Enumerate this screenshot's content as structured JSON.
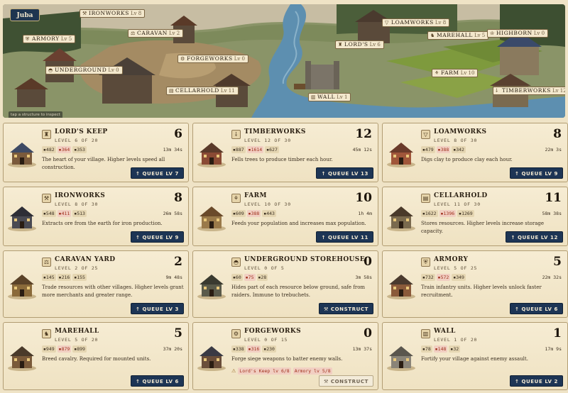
{
  "village": {
    "name": "Juba"
  },
  "map": {
    "hint": "tap a structure to inspect",
    "labels": [
      {
        "key": "ironworks",
        "name": "IRONWORKS",
        "lv": "Lv 8",
        "icon": "anvil-icon",
        "glyph": "⚒"
      },
      {
        "key": "armory",
        "name": "ARMORY",
        "lv": "Lv 5",
        "icon": "shield-icon",
        "glyph": "⛨"
      },
      {
        "key": "caravan",
        "name": "CARAVAN",
        "lv": "Lv 2",
        "icon": "scale-icon",
        "glyph": "⚖"
      },
      {
        "key": "forgeworks",
        "name": "FORGEWORKS",
        "lv": "Lv 0",
        "icon": "catapult-icon",
        "glyph": "⚙"
      },
      {
        "key": "underground",
        "name": "UNDERGROUND",
        "lv": "Lv 0",
        "icon": "cave-icon",
        "glyph": "◓"
      },
      {
        "key": "cellarhold",
        "name": "CELLARHOLD",
        "lv": "Lv 11",
        "icon": "crate-icon",
        "glyph": "▤"
      },
      {
        "key": "lords",
        "name": "LORD'S",
        "lv": "Lv 6",
        "icon": "castle-icon",
        "glyph": "♜"
      },
      {
        "key": "wall",
        "name": "WALL",
        "lv": "Lv 1",
        "icon": "wall-icon",
        "glyph": "▥"
      },
      {
        "key": "loamworks",
        "name": "LOAMWORKS",
        "lv": "Lv 8",
        "icon": "bucket-icon",
        "glyph": "▽"
      },
      {
        "key": "marehall",
        "name": "MAREHALL",
        "lv": "Lv 5",
        "icon": "horse-icon",
        "glyph": "♞"
      },
      {
        "key": "highborn",
        "name": "HIGHBORN",
        "lv": "Lv 0",
        "icon": "crown-icon",
        "glyph": "♔"
      },
      {
        "key": "farm",
        "name": "FARM",
        "lv": "Lv 10",
        "icon": "wheat-icon",
        "glyph": "⚘"
      },
      {
        "key": "timberworks",
        "name": "TIMBERWORKS",
        "lv": "Lv 12",
        "icon": "axe-icon",
        "glyph": "⸸"
      }
    ]
  },
  "colors": {
    "queue_button": "#1d3555",
    "short_resource": "#a0301e",
    "card_background": "#f6ecd3",
    "page_background": "#efe3c6"
  },
  "buildings": [
    {
      "key": "lords_keep",
      "name": "LORD'S KEEP",
      "icon": "castle-icon",
      "glyph": "♜",
      "level_text": "LEVEL 6 OF 20",
      "level": "6",
      "costs": [
        {
          "v": "▪482",
          "short": false
        },
        {
          "v": "▪364",
          "short": true
        },
        {
          "v": "▪353",
          "short": false
        }
      ],
      "time": "13m 34s",
      "desc": "The heart of your village. Higher levels speed all construction.",
      "button": "↑ QUEUE LV 7",
      "btn_disabled": false,
      "req": []
    },
    {
      "key": "timberworks",
      "name": "TIMBERWORKS",
      "icon": "axe-icon",
      "glyph": "⸸",
      "level_text": "LEVEL 12 OF 30",
      "level": "12",
      "costs": [
        {
          "v": "▪887",
          "short": false
        },
        {
          "v": "▪1614",
          "short": true
        },
        {
          "v": "▪627",
          "short": false
        }
      ],
      "time": "45m 12s",
      "desc": "Fells trees to produce timber each hour.",
      "button": "↑ QUEUE LV 13",
      "btn_disabled": false,
      "req": []
    },
    {
      "key": "loamworks",
      "name": "LOAMWORKS",
      "icon": "bucket-icon",
      "glyph": "▽",
      "level_text": "LEVEL 8 OF 30",
      "level": "8",
      "costs": [
        {
          "v": "▪479",
          "short": false
        },
        {
          "v": "▪388",
          "short": true
        },
        {
          "v": "▪342",
          "short": false
        }
      ],
      "time": "22m 3s",
      "desc": "Digs clay to produce clay each hour.",
      "button": "↑ QUEUE LV 9",
      "btn_disabled": false,
      "req": []
    },
    {
      "key": "ironworks",
      "name": "IRONWORKS",
      "icon": "anvil-icon",
      "glyph": "⚒",
      "level_text": "LEVEL 8 OF 30",
      "level": "8",
      "costs": [
        {
          "v": "▪548",
          "short": false
        },
        {
          "v": "▪411",
          "short": true
        },
        {
          "v": "▪513",
          "short": false
        }
      ],
      "time": "26m 58s",
      "desc": "Extracts ore from the earth for iron production.",
      "button": "↑ QUEUE LV 9",
      "btn_disabled": false,
      "req": []
    },
    {
      "key": "farm",
      "name": "FARM",
      "icon": "wheat-icon",
      "glyph": "⚘",
      "level_text": "LEVEL 10 OF 30",
      "level": "10",
      "costs": [
        {
          "v": "▪609",
          "short": false
        },
        {
          "v": "▪388",
          "short": true
        },
        {
          "v": "▪443",
          "short": false
        }
      ],
      "time": "1h 4m",
      "desc": "Feeds your population and increases max population.",
      "button": "↑ QUEUE LV 11",
      "btn_disabled": false,
      "req": []
    },
    {
      "key": "cellarhold",
      "name": "CELLARHOLD",
      "icon": "crate-icon",
      "glyph": "▤",
      "level_text": "LEVEL 11 OF 30",
      "level": "11",
      "costs": [
        {
          "v": "▪1622",
          "short": false
        },
        {
          "v": "▪1396",
          "short": true
        },
        {
          "v": "▪1269",
          "short": false
        }
      ],
      "time": "58m 38s",
      "desc": "Stores resources. Higher levels increase storage capacity.",
      "button": "↑ QUEUE LV 12",
      "btn_disabled": false,
      "req": []
    },
    {
      "key": "caravan_yard",
      "name": "CARAVAN YARD",
      "icon": "scale-icon",
      "glyph": "⚖",
      "level_text": "LEVEL 2 OF 25",
      "level": "2",
      "costs": [
        {
          "v": "▪145",
          "short": false
        },
        {
          "v": "▪216",
          "short": false
        },
        {
          "v": "▪155",
          "short": false
        }
      ],
      "time": "9m 48s",
      "desc": "Trade resources with other villages. Higher levels grant more merchants and greater range.",
      "button": "↑ QUEUE LV 3",
      "btn_disabled": false,
      "req": []
    },
    {
      "key": "underground_storehouse",
      "name": "UNDERGROUND STOREHOUSE",
      "icon": "cave-icon",
      "glyph": "◓",
      "level_text": "LEVEL 0 OF 5",
      "level": "0",
      "costs": [
        {
          "v": "▪60",
          "short": false
        },
        {
          "v": "▪75",
          "short": true
        },
        {
          "v": "▪28",
          "short": false
        }
      ],
      "time": "3m 58s",
      "desc": "Hides part of each resource below ground, safe from raiders. Immune to trebuchets.",
      "button": "⚒ CONSTRUCT",
      "btn_disabled": false,
      "req": []
    },
    {
      "key": "armory",
      "name": "ARMORY",
      "icon": "shield-icon",
      "glyph": "⛨",
      "level_text": "LEVEL 5 OF 25",
      "level": "5",
      "costs": [
        {
          "v": "▪732",
          "short": false
        },
        {
          "v": "▪572",
          "short": true
        },
        {
          "v": "▪349",
          "short": false
        }
      ],
      "time": "22m 32s",
      "desc": "Train infantry units. Higher levels unlock faster recruitment.",
      "button": "↑ QUEUE LV 6",
      "btn_disabled": false,
      "req": []
    },
    {
      "key": "marehall",
      "name": "MAREHALL",
      "icon": "horse-icon",
      "glyph": "♞",
      "level_text": "LEVEL 5 OF 20",
      "level": "5",
      "costs": [
        {
          "v": "▪949",
          "short": false
        },
        {
          "v": "▪879",
          "short": true
        },
        {
          "v": "▪899",
          "short": false
        }
      ],
      "time": "37m 20s",
      "desc": "Breed cavalry. Required for mounted units.",
      "button": "↑ QUEUE LV 6",
      "btn_disabled": false,
      "req": []
    },
    {
      "key": "forgeworks",
      "name": "FORGEWORKS",
      "icon": "catapult-icon",
      "glyph": "⚙",
      "level_text": "LEVEL 0 OF 15",
      "level": "0",
      "costs": [
        {
          "v": "▪338",
          "short": false
        },
        {
          "v": "▪316",
          "short": true
        },
        {
          "v": "▪230",
          "short": false
        }
      ],
      "time": "13m 37s",
      "desc": "Forge siege weapons to batter enemy walls.",
      "button": "⚒ CONSTRUCT",
      "btn_disabled": true,
      "req": [
        "Lord's Keep lv 6/8",
        "Armory lv 5/8"
      ]
    },
    {
      "key": "wall",
      "name": "WALL",
      "icon": "wall-icon",
      "glyph": "▥",
      "level_text": "LEVEL 1 OF 20",
      "level": "1",
      "costs": [
        {
          "v": "▪78",
          "short": false
        },
        {
          "v": "▪148",
          "short": true
        },
        {
          "v": "▪32",
          "short": false
        }
      ],
      "time": "17m 9s",
      "desc": "Fortify your village against enemy assault.",
      "button": "↑ QUEUE LV 2",
      "btn_disabled": false,
      "req": []
    }
  ]
}
